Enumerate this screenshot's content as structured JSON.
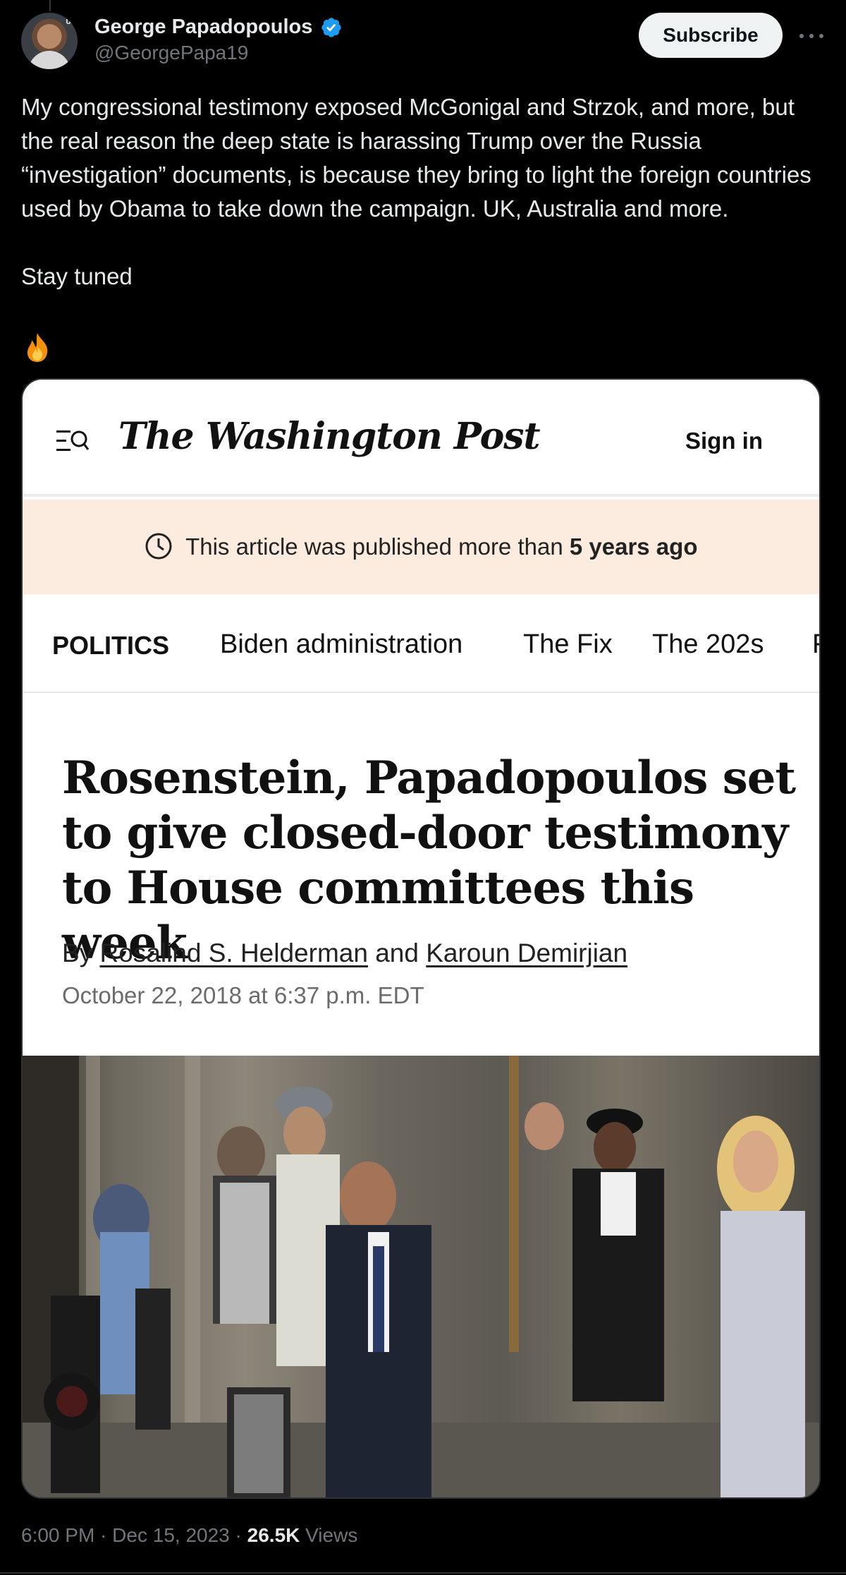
{
  "tweet": {
    "author_name": "George Papadopoulos",
    "author_handle": "@GeorgePapa19",
    "avatar_tag": "UN",
    "subscribe_label": "Subscribe",
    "text_line1": "My congressional testimony exposed McGonigal and Strzok, and more, but the real reason the deep state is harassing Trump over the Russia “investigation” documents, is because they bring to light the foreign countries used by Obama to take down the campaign. UK, Australia and more.",
    "text_line2": "Stay tuned",
    "time": "6:00 PM",
    "separator": "·",
    "date": "Dec 15, 2023",
    "views_count": "26.5K",
    "views_label": "Views"
  },
  "card": {
    "logo": "The Washington Post",
    "sign_in_label": "Sign in",
    "notice_prefix": "This article was published more than",
    "notice_bold": "5 years ago",
    "nav": [
      "POLITICS",
      "Biden administration",
      "The Fix",
      "The 202s",
      "F"
    ],
    "headline": "Rosenstein, Papadopoulos set to give closed-door testimony to House committees this week",
    "byline_by": "By",
    "author1": "Rosalind S. Helderman",
    "byline_and": "and",
    "author2": "Karoun Demirjian",
    "dateline": "October 22, 2018 at 6:37 p.m. EDT"
  },
  "colors": {
    "background": "#000000",
    "accent_blue": "#1d9bf0",
    "notice_bg": "#fcecdf",
    "muted_text": "#71767b"
  },
  "icons": [
    "verified-badge-icon",
    "more-icon",
    "fire-icon",
    "menu-search-icon",
    "clock-icon"
  ]
}
